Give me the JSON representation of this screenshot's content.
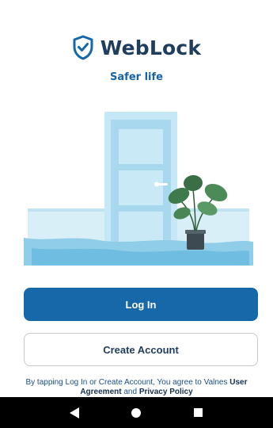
{
  "app": {
    "name": "WebLock",
    "tagline": "Safer life"
  },
  "actions": {
    "login_label": "Log In",
    "create_label": "Create Account"
  },
  "terms": {
    "prefix": "By tapping Log In or Create Account, You agree to Valnes ",
    "user_agreement": "User Agreement",
    "middle": " and ",
    "privacy_policy": "Privacy Policy"
  },
  "icons": {
    "brand": "shield-check-icon",
    "nav_back": "triangle-back-icon",
    "nav_home": "circle-home-icon",
    "nav_recents": "square-recents-icon"
  },
  "colors": {
    "brand_dark": "#1f3d5c",
    "accent": "#1668a8",
    "door_light": "#bfe3f2",
    "nav_bar": "#000000"
  }
}
